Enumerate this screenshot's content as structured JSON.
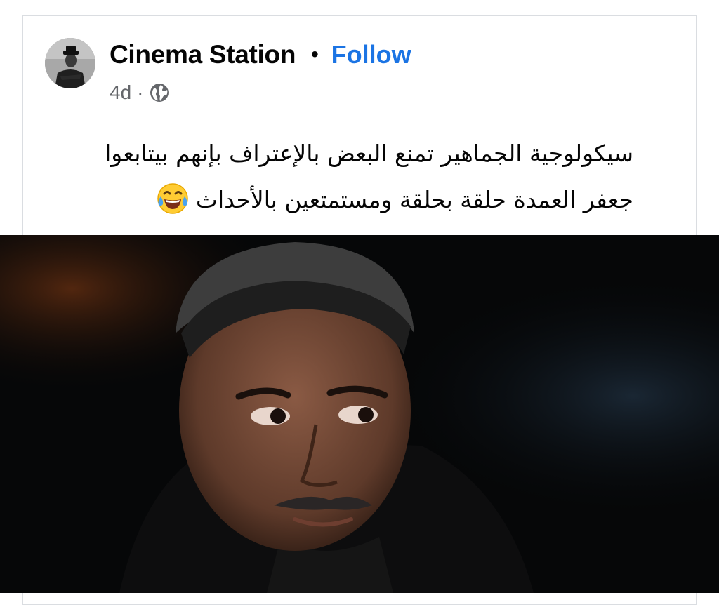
{
  "post": {
    "page_name": "Cinema Station",
    "separator": "•",
    "follow_label": "Follow",
    "timestamp": "4d",
    "meta_separator": "·",
    "audience_icon": "globe-icon",
    "text_line_1": "سيكولوجية الجماهير تمنع البعض بالإعتراف بإنهم بيتابعوا",
    "text_line_2": "جعفر العمدة حلقة بحلقة ومستمتعين بالأحداث",
    "emoji": "face-with-tears-of-joy-icon"
  },
  "colors": {
    "follow": "#1b74e4",
    "meta": "#65676b",
    "text": "#050505",
    "border": "#dadde1"
  }
}
